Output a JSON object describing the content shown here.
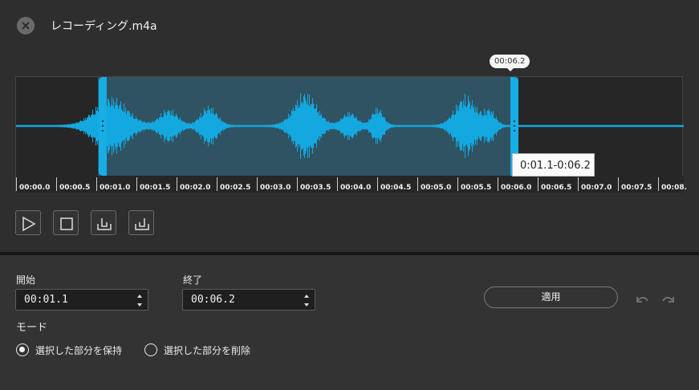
{
  "header": {
    "title": "レコーディング.m4a"
  },
  "waveform": {
    "cursor_time": "00:06.2",
    "range_tooltip": "0:01.1-0:06.2",
    "selection_color": "#17aee6",
    "timeline_labels": [
      "00:00.0",
      "00:00.5",
      "00:01.0",
      "00:01.5",
      "00:02.0",
      "00:02.5",
      "00:03.0",
      "00:03.5",
      "00:04.0",
      "00:04.5",
      "00:05.0",
      "00:05.5",
      "00:06.0",
      "00:06.5",
      "00:07.0",
      "00:07.5",
      "00:08."
    ]
  },
  "toolbar": {
    "play_icon": "play-icon",
    "stop_icon": "stop-icon",
    "set_start_icon": "set-start-icon",
    "set_end_icon": "set-end-icon"
  },
  "trim": {
    "start_label": "開始",
    "start_value": "00:01.1",
    "end_label": "終了",
    "end_value": "00:06.2",
    "apply_label": "適用"
  },
  "mode": {
    "label": "モード",
    "options": [
      {
        "label": "選択した部分を保持",
        "selected": true
      },
      {
        "label": "選択した部分を削除",
        "selected": false
      }
    ]
  }
}
